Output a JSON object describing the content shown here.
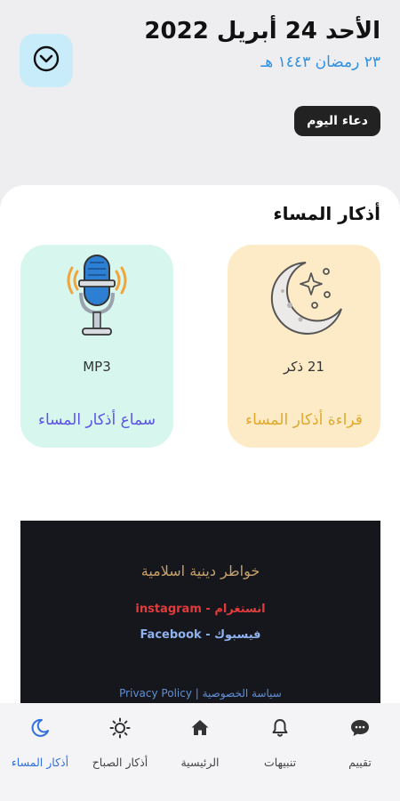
{
  "header": {
    "gregorian_date": "الأحد 24 أبريل 2022",
    "hijri_date": "٢٣ رمضان ١٤٤٣ هـ",
    "dua_button": "دعاء اليوم"
  },
  "section": {
    "title": "أذكار المساء"
  },
  "cards": {
    "reading": {
      "count": "21 ذكر",
      "label": "قراءة أذكار المساء"
    },
    "listen": {
      "format": "MP3",
      "label": "سماع أذكار المساء"
    }
  },
  "banner": {
    "title": "خواطر دينية اسلامية",
    "instagram": "انستغرام - instagram",
    "facebook": "فيسبوك - Facebook",
    "privacy": "سياسة الخصوصية | Privacy Policy"
  },
  "nav": {
    "items": [
      {
        "label": "تقييم",
        "icon": "chat-bubble-icon"
      },
      {
        "label": "تنبيهات",
        "icon": "bell-icon"
      },
      {
        "label": "الرئيسية",
        "icon": "home-icon"
      },
      {
        "label": "أذكار الصباح",
        "icon": "sun-icon"
      },
      {
        "label": "أذكار المساء",
        "icon": "moon-icon"
      }
    ],
    "active": "أذكار المساء"
  },
  "colors": {
    "accent_blue": "#2f8fe0",
    "reading_card": "#fdebc8",
    "listen_card": "#d7f6ee",
    "reading_label": "#e0a92c",
    "listen_label": "#5b54e6"
  }
}
